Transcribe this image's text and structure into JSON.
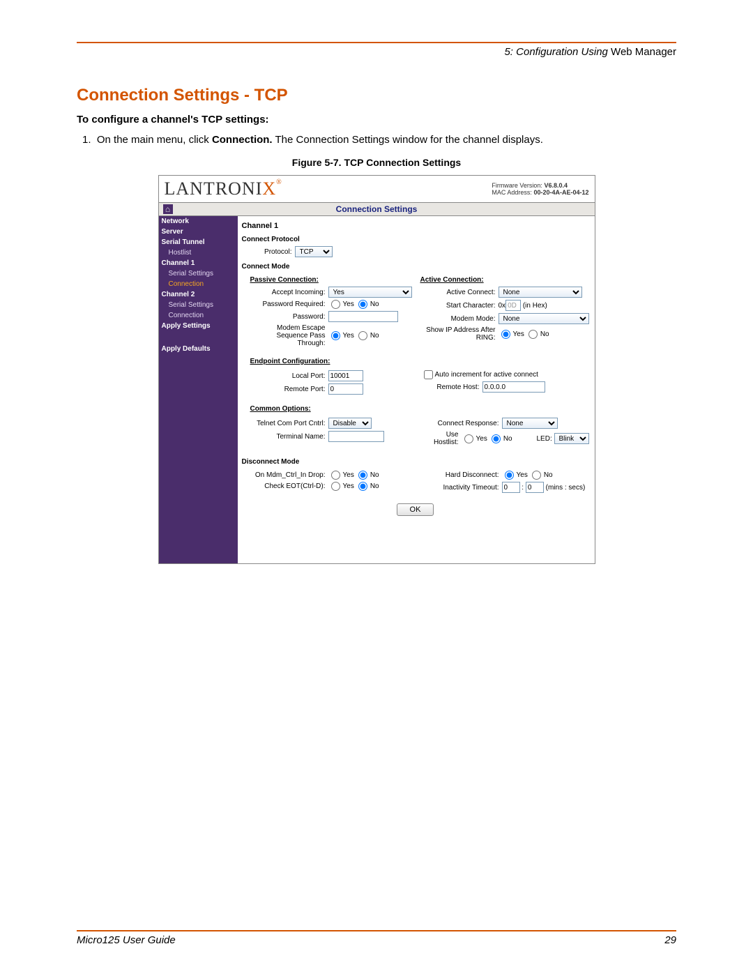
{
  "header": {
    "chapter": "5: Configuration Using",
    "chapter_suffix": " Web Manager"
  },
  "section": {
    "title": "Connection Settings - TCP",
    "subtitle": "To configure a channel's TCP settings:",
    "step_num": "1.",
    "step_text_a": "On the main menu, click ",
    "step_bold": "Connection.",
    "step_text_b": " The Connection Settings window for the channel displays.",
    "figure": "Figure 5-7. TCP Connection Settings"
  },
  "shot": {
    "logo_main": "LANTRONI",
    "logo_x": "X",
    "fw_label": "Firmware Version:",
    "fw_value": "V6.8.0.4",
    "mac_label": "MAC Address:",
    "mac_value": "00-20-4A-AE-04-12",
    "title": "Connection Settings",
    "sidebar": [
      {
        "t": "Network",
        "b": true
      },
      {
        "t": "Server",
        "b": true
      },
      {
        "t": "Serial Tunnel",
        "b": true
      },
      {
        "t": "Hostlist",
        "sub": true
      },
      {
        "t": "Channel 1",
        "b": true
      },
      {
        "t": "Serial Settings",
        "sub": true
      },
      {
        "t": "Connection",
        "sub": true,
        "active": true
      },
      {
        "t": "Channel 2",
        "b": true
      },
      {
        "t": "Serial Settings",
        "sub": true
      },
      {
        "t": "Connection",
        "sub": true
      },
      {
        "t": "Apply Settings",
        "b": true
      },
      {
        "t": "",
        "sep": true
      },
      {
        "t": "Apply Defaults",
        "b": true
      }
    ],
    "channel_title": "Channel 1",
    "connect_protocol_label": "Connect Protocol",
    "protocol_label": "Protocol:",
    "protocol_value": "TCP",
    "connect_mode_label": "Connect Mode",
    "passive_label": "Passive Connection:",
    "active_label": "Active Connection:",
    "accept_incoming_label": "Accept Incoming:",
    "accept_incoming_value": "Yes",
    "active_connect_label": "Active Connect:",
    "active_connect_value": "None",
    "password_required_label": "Password Required:",
    "start_char_label": "Start Character:",
    "start_char_prefix": "0x",
    "start_char_value": "0D",
    "start_char_suffix": "(in Hex)",
    "password_label": "Password:",
    "modem_mode_label": "Modem Mode:",
    "modem_mode_value": "None",
    "modem_escape_label": "Modem Escape Sequence Pass Through:",
    "show_ip_label": "Show IP Address After RING:",
    "endpoint_label": "Endpoint Configuration:",
    "local_port_label": "Local Port:",
    "local_port_value": "10001",
    "auto_increment_label": "Auto increment for active connect",
    "remote_port_label": "Remote Port:",
    "remote_port_value": "0",
    "remote_host_label": "Remote Host:",
    "remote_host_value": "0.0.0.0",
    "common_options_label": "Common Options:",
    "telnet_label": "Telnet Com Port Cntrl:",
    "telnet_value": "Disable",
    "connect_response_label": "Connect Response:",
    "connect_response_value": "None",
    "terminal_name_label": "Terminal Name:",
    "use_hostlist_label": "Use Hostlist:",
    "led_label": "LED:",
    "led_value": "Blink",
    "disconnect_mode_label": "Disconnect Mode",
    "on_mdm_label": "On Mdm_Ctrl_In Drop:",
    "hard_disconnect_label": "Hard Disconnect:",
    "check_eot_label": "Check EOT(Ctrl-D):",
    "inactivity_label": "Inactivity Timeout:",
    "inactivity_m": "0",
    "inactivity_s": "0",
    "inactivity_units": "(mins : secs)",
    "colon": ":",
    "yes": "Yes",
    "no": "No",
    "ok": "OK"
  },
  "footer": {
    "guide": "Micro125 User Guide",
    "page": "29"
  }
}
